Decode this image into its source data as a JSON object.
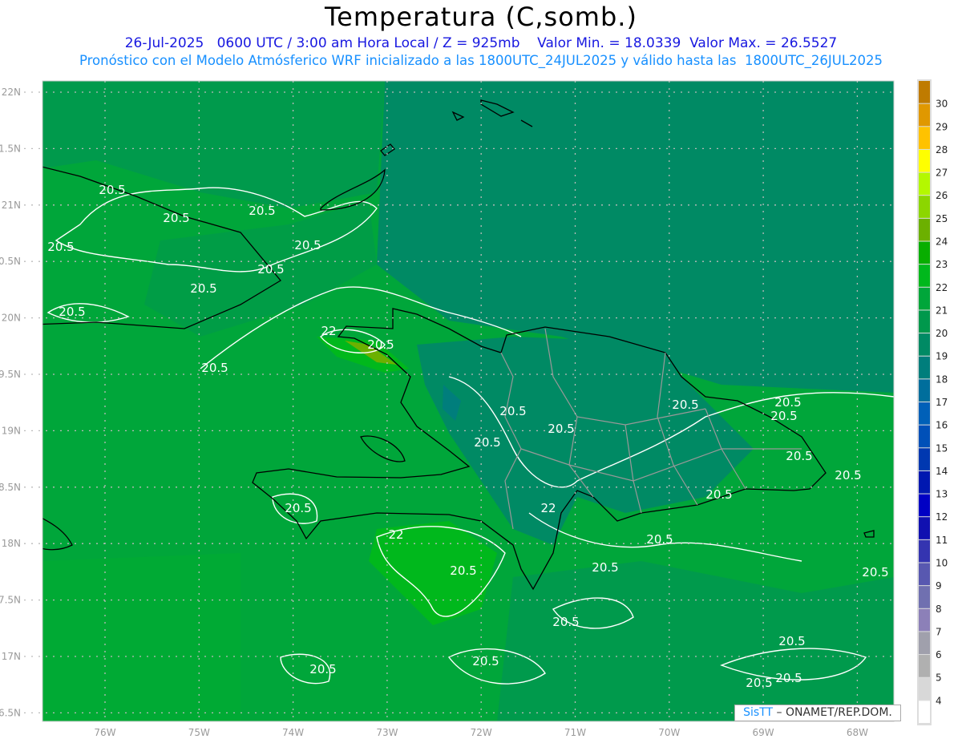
{
  "header": {
    "title": "Temperatura (C,somb.)",
    "subtitle_line1": "26-Jul-2025   0600 UTC / 3:00 am Hora Local / Z = 925mb    Valor Min. = 18.0339  Valor Max. = 26.5527",
    "subtitle_line2": "Pronóstico con el Modelo Atmósferico WRF inicializado a las 1800UTC_24JUL2025 y válido hasta las  1800UTC_26JUL2025"
  },
  "map": {
    "variable": "Temperatura",
    "level": "925mb",
    "valid_date": "26-Jul-2025",
    "valid_time": "0600 UTC",
    "min_value": 18.0339,
    "max_value": 26.5527,
    "lon_labels": [
      "76W",
      "75W",
      "74W",
      "73W",
      "72W",
      "71W",
      "70W",
      "69W",
      "68W"
    ],
    "lat_labels": [
      "22N",
      "1.5N",
      "21N",
      "0.5N",
      "20N",
      "9.5N",
      "19N",
      "8.5N",
      "18N",
      "7.5N",
      "17N",
      "6.5N"
    ],
    "contour_labels": [
      "20.5",
      "20.5",
      "20.5",
      "20.5",
      "20.5",
      "20.5",
      "20.5",
      "20.5",
      "22",
      "20.5",
      "20.5",
      "20.5",
      "20.5",
      "20.5",
      "20.5",
      "20.5",
      "20.5",
      "20.5",
      "20.5",
      "20.5",
      "22",
      "22",
      "20.5",
      "20.5",
      "20.5",
      "20.5",
      "20.5",
      "20.5",
      "20.5",
      "20.5"
    ]
  },
  "colorbar": {
    "labels": [
      "30",
      "29",
      "28",
      "27",
      "26",
      "25",
      "24",
      "23",
      "22",
      "21",
      "20",
      "19",
      "18",
      "17",
      "16",
      "15",
      "14",
      "13",
      "12",
      "11",
      "10",
      "9",
      "8",
      "7",
      "6",
      "5",
      "4"
    ],
    "colors": [
      "#bf7b00",
      "#e09800",
      "#ffc200",
      "#ffff00",
      "#b4f800",
      "#8cd600",
      "#6cb000",
      "#08ae00",
      "#00b81c",
      "#00a63a",
      "#00984c",
      "#008a64",
      "#007e7c",
      "#006e9c",
      "#0060b8",
      "#0050b8",
      "#0038b0",
      "#0018b0",
      "#0000c4",
      "#1010b0",
      "#3434b0",
      "#5858b0",
      "#7070b0",
      "#8c80b8",
      "#a0a0ac",
      "#b0b0b0",
      "#d8d8d8",
      "#ffffff"
    ]
  },
  "credit": {
    "brand": "SisTT",
    "text": " – ONAMET/REP.DOM."
  }
}
